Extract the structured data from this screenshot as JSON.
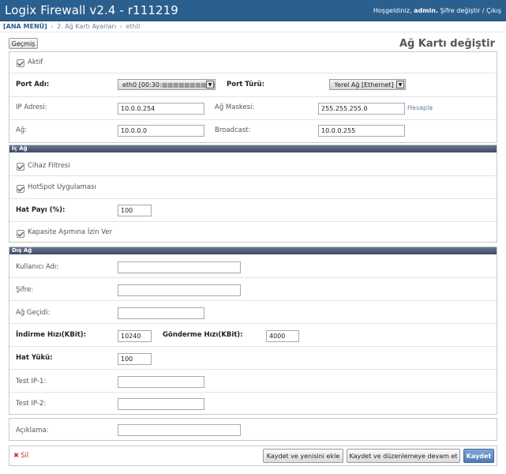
{
  "app": {
    "title": "Logix Firewall v2.4 - r111219",
    "greeting": "Hoşgeldiniz,",
    "user": "admin.",
    "change_password": "Şifre değiştir",
    "logout_sep": "/",
    "logout": "Çıkış"
  },
  "breadcrumb": {
    "root": "[ANA MENÜ]",
    "sep": "›",
    "item1": "2. Ağ Kartı Ayarları",
    "item2": "eth0"
  },
  "header": {
    "history_label": "Geçmiş",
    "page_title": "Ağ Kartı değiştir"
  },
  "general": {
    "active_label": "Aktif",
    "port_name_label": "Port Adı:",
    "port_name_value": "eth0 [00:30:",
    "port_name_masked": "■■■■■■■■■■",
    "port_type_label": "Port Türü:",
    "port_type_value": "Yerel Ağ [Ethernet]",
    "ip_label": "IP Adresi:",
    "ip_value": "10.0.0.254",
    "mask_label": "Ağ Maskesi:",
    "mask_value": "255.255.255.0",
    "calc_link": "Hesapla",
    "network_label": "Ağ:",
    "network_value": "10.0.0.0",
    "broadcast_label": "Broadcast:",
    "broadcast_value": "10.0.0.255"
  },
  "internal": {
    "section_title": "İç Ağ",
    "device_filter_label": "Cihaz Filtresi",
    "hotspot_label": "HotSpot Uygulaması",
    "share_label": "Hat Payı (%):",
    "share_value": "100",
    "capacity_label": "Kapasite Aşımına İzin Ver"
  },
  "external": {
    "section_title": "Dış Ağ",
    "username_label": "Kullanıcı Adı:",
    "username_value": "",
    "password_label": "Şifre:",
    "password_value": "",
    "gateway_label": "Ağ Geçidi:",
    "gateway_value": "",
    "download_label": "İndirme Hızı(KBit):",
    "download_value": "10240",
    "upload_label": "Gönderme Hızı(KBit):",
    "upload_value": "4000",
    "load_label": "Hat Yükü:",
    "load_value": "100",
    "test_ip1_label": "Test IP-1:",
    "test_ip1_value": "",
    "test_ip2_label": "Test IP-2:",
    "test_ip2_value": ""
  },
  "description": {
    "label": "Açıklama:",
    "value": ""
  },
  "actions": {
    "delete_icon": "x-icon",
    "delete_label": "Sil",
    "save_add_label": "Kaydet ve yenisini ekle",
    "save_continue_label": "Kaydet ve düzenlemeye devam et",
    "save_label": "Kaydet"
  }
}
